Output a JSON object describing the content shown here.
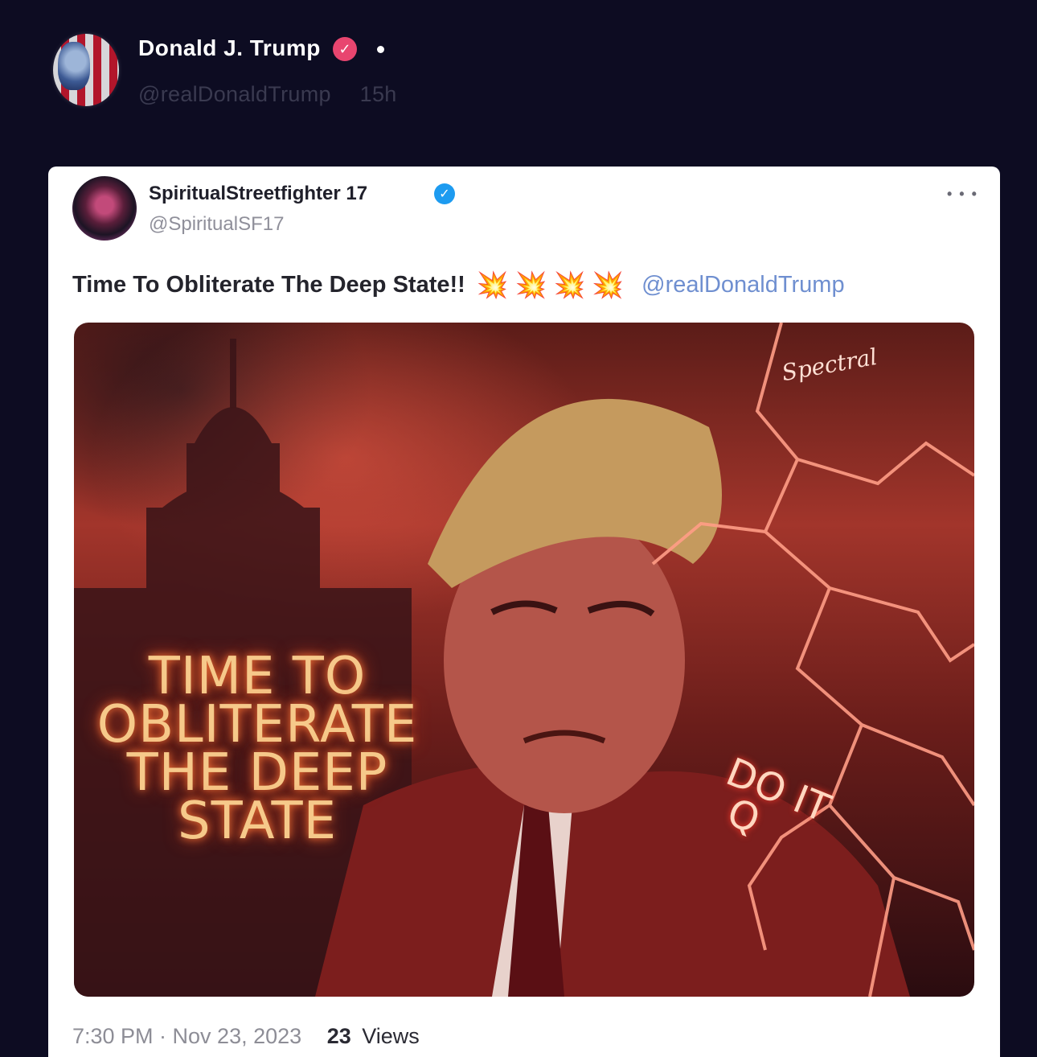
{
  "post": {
    "author_name": "Donald J. Trump",
    "author_handle": "@realDonaldTrump",
    "time_ago": "15h",
    "verified_icon": "check-badge-icon",
    "badge_color": "#e8456f"
  },
  "quoted": {
    "author_name": "SpiritualStreetfighter 17",
    "author_handle": "@SpiritualSF17",
    "verified_icon": "check-badge-icon",
    "badge_color": "#1d9bf0",
    "text": "Time To Obliterate The Deep State!!",
    "emoji": [
      "💥",
      "💥",
      "💥",
      "💥"
    ],
    "mention": "@realDonaldTrump",
    "more_icon": "more-options-icon",
    "media": {
      "poster_text_lines": [
        "TIME TO",
        "OBLITERATE",
        "THE DEEP",
        "STATE"
      ],
      "lapel_text_lines": [
        "DO IT",
        "Q"
      ],
      "signature": "Spectral"
    },
    "timestamp": "7:30 PM · Nov 23, 2023",
    "views_count": "23",
    "views_label": "Views"
  }
}
